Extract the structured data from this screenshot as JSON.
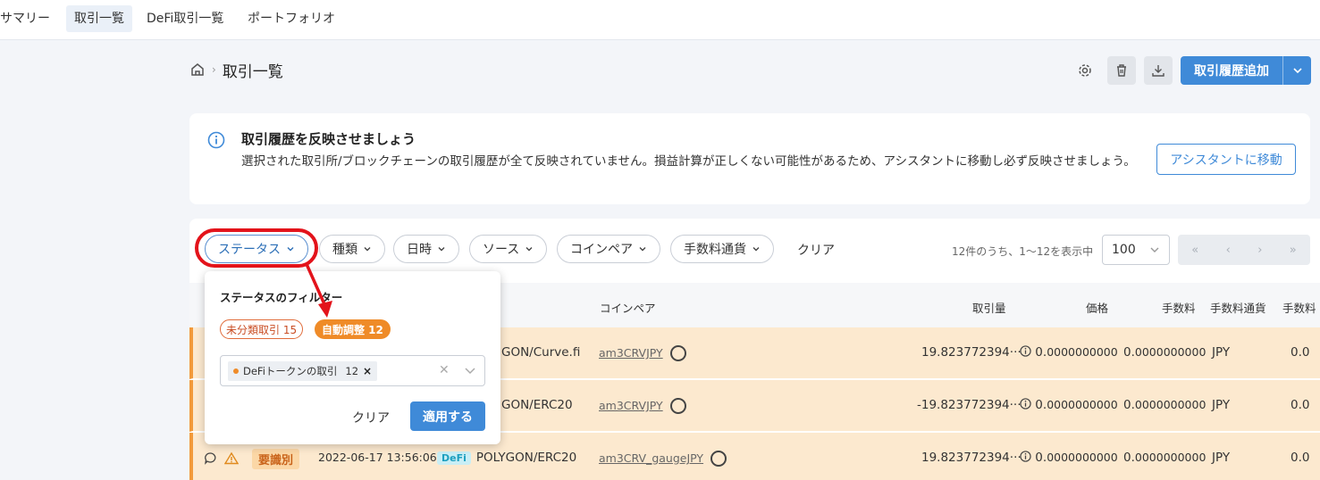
{
  "topnav": {
    "tabs": [
      {
        "label": "サマリー"
      },
      {
        "label": "取引一覧"
      },
      {
        "label": "DeFi取引一覧"
      },
      {
        "label": "ポートフォリオ"
      }
    ]
  },
  "breadcrumb": {
    "title": "取引一覧"
  },
  "header": {
    "add_label": "取引履歴追加"
  },
  "notice": {
    "title": "取引履歴を反映させましょう",
    "body": "選択された取引所/ブロックチェーンの取引履歴が全て反映されていません。損益計算が正しくない可能性があるため、アシスタントに移動し必ず反映させましょう。",
    "button": "アシスタントに移動"
  },
  "filters": {
    "chips": [
      "ステータス",
      "種類",
      "日時",
      "ソース",
      "コインペア",
      "手数料通貨"
    ],
    "clear": "クリア"
  },
  "pagination": {
    "summary": "12件のうち、1〜12を表示中",
    "per_page": "100"
  },
  "table": {
    "headers": {
      "coinpair": "コインペア",
      "amount": "取引量",
      "price": "価格",
      "fee": "手数料",
      "fee_currency": "手数料通貨",
      "fee2": "手数料"
    },
    "rows": [
      {
        "source": "GON/Curve.fi",
        "coin": "am3CRVJPY",
        "amount": "19.823772394···",
        "price_int": "0.",
        "price_dec": "0000000000",
        "fee_int": "0.",
        "fee_dec": "0000000000",
        "fee_currency": "JPY",
        "fee2": "0.0"
      },
      {
        "source": "GON/ERC20",
        "coin": "am3CRVJPY",
        "amount": "-19.823772394···",
        "price_int": "0.",
        "price_dec": "0000000000",
        "fee_int": "0.",
        "fee_dec": "0000000000",
        "fee_currency": "JPY",
        "fee2": "0.0"
      },
      {
        "tag": "要識別",
        "date": "2022-06-17 13:56:06",
        "defi": "DeFi",
        "source": "POLYGON/ERC20",
        "coin": "am3CRV_gaugeJPY",
        "amount": "19.823772394···",
        "price_int": "0.",
        "price_dec": "0000000000",
        "fee_int": "0.",
        "fee_dec": "0000000000",
        "fee_currency": "JPY",
        "fee2": "0.0"
      }
    ]
  },
  "popup": {
    "title": "ステータスのフィルター",
    "badge_unclassified": "未分類取引 15",
    "badge_auto": "自動調整 12",
    "selected_chip": "DeFiトークンの取引",
    "selected_count": "12",
    "clear": "クリア",
    "apply": "適用する"
  },
  "colors": {
    "accent": "#3f8ad8",
    "row_highlight": "#fce9cf",
    "row_border": "#f29a3b",
    "annotation": "#e3131b"
  }
}
